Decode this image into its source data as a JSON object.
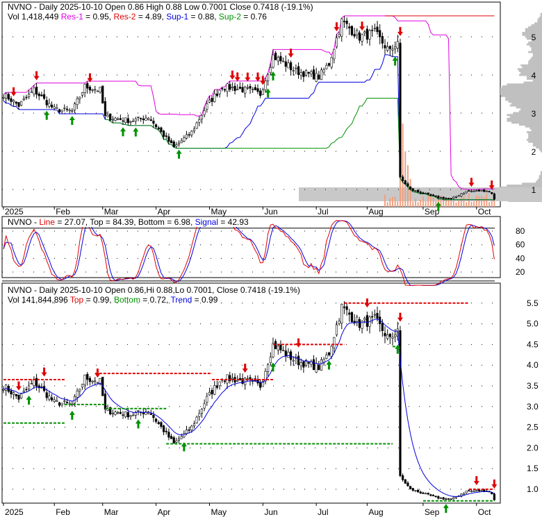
{
  "panel1": {
    "line1": "NVNO - Daily 2025-10-10 Open 0.86  High 0.88  Low 0.7001  Close 0.7418 (-19.1%)",
    "vol": "Vol 1,418,449",
    "res1_label": "Res-1",
    "res1_val": " = 0.95, ",
    "res2_label": "Res-2",
    "res2_val": " = 4.89, ",
    "sup1_label": "Sup-1",
    "sup1_val": " = 0.88, ",
    "sup2_label": "Sup-2",
    "sup2_val": " = 0.76"
  },
  "panel2": {
    "prefix": "NVNO - ",
    "line_label": "Line",
    "rest": " = 27.07, Top = 84.39, Bottom = 6.98, ",
    "signal_label": "Signal",
    "signal_val": " = 42.93"
  },
  "panel3": {
    "line1": "NVNO - Daily 2025-10-10 Open 0.86,Hi 0.88,Lo 0.7001, Close 0.7418 (-19.1%)",
    "vol": "Vol 141,844,896 ",
    "top_label": "Top",
    "top_val": " = 0.99, ",
    "bottom_label": "Bottom",
    "bottom_val": " = 0.72, ",
    "trend_label": "Trend",
    "trend_val": " = 0.99"
  },
  "chart_data": {
    "type": "candlestick",
    "ticker": "NVNO",
    "x_months": [
      {
        "label": "2025",
        "day": 0
      },
      {
        "label": "Feb",
        "day": 20
      },
      {
        "label": "Mar",
        "day": 39
      },
      {
        "label": "Apr",
        "day": 60
      },
      {
        "label": "May",
        "day": 81
      },
      {
        "label": "Jun",
        "day": 102
      },
      {
        "label": "Jul",
        "day": 123
      },
      {
        "label": "Aug",
        "day": 143
      },
      {
        "label": "Sep",
        "day": 165
      },
      {
        "label": "Oct",
        "day": 186
      }
    ],
    "close_keypoints": [
      [
        0,
        3.5
      ],
      [
        6,
        3.2
      ],
      [
        12,
        3.6
      ],
      [
        20,
        3.1
      ],
      [
        27,
        3.05
      ],
      [
        32,
        3.7
      ],
      [
        38,
        3.6
      ],
      [
        40,
        2.9
      ],
      [
        50,
        2.8
      ],
      [
        57,
        2.9
      ],
      [
        62,
        2.5
      ],
      [
        67,
        2.1
      ],
      [
        74,
        2.5
      ],
      [
        80,
        3.2
      ],
      [
        86,
        3.7
      ],
      [
        96,
        3.6
      ],
      [
        101,
        3.5
      ],
      [
        106,
        4.5
      ],
      [
        115,
        4.1
      ],
      [
        124,
        3.95
      ],
      [
        128,
        4.3
      ],
      [
        133,
        5.4
      ],
      [
        140,
        5.0
      ],
      [
        146,
        5.1
      ],
      [
        152,
        4.6
      ],
      [
        155,
        4.9
      ],
      [
        156,
        1.3
      ],
      [
        160,
        1.0
      ],
      [
        170,
        0.8
      ],
      [
        176,
        0.75
      ],
      [
        182,
        0.95
      ],
      [
        190,
        0.97
      ],
      [
        192,
        0.9
      ],
      [
        193,
        0.74
      ]
    ],
    "last_day": 193,
    "panel1_yticks": [
      1,
      2,
      3,
      4,
      5
    ],
    "panel2_yticks": [
      20,
      40,
      60,
      80
    ],
    "panel3_yticks": [
      1.0,
      1.5,
      2.0,
      2.5,
      3.0,
      3.5,
      4.0,
      4.5,
      5.0,
      5.5
    ],
    "panel1_sell_arrows": [
      4,
      13,
      34,
      90,
      92,
      96,
      100,
      102,
      113,
      131,
      141,
      156,
      184,
      192
    ],
    "panel1_buy_arrows": [
      17,
      27,
      47,
      52,
      69,
      104,
      106,
      154,
      171
    ],
    "panel3_sell_arrows": [
      6,
      16,
      37,
      95,
      116,
      143,
      156,
      186,
      193
    ],
    "panel3_buy_arrows": [
      10,
      27,
      53,
      71,
      106,
      128,
      155,
      174
    ],
    "panel3_top_levels": [
      [
        0,
        24,
        3.65
      ],
      [
        36,
        82,
        3.8
      ],
      [
        82,
        106,
        3.65
      ],
      [
        106,
        134,
        4.5
      ],
      [
        134,
        183,
        5.5
      ],
      [
        183,
        193,
        1.0
      ]
    ],
    "panel3_bottom_levels": [
      [
        0,
        24,
        2.6
      ],
      [
        24,
        40,
        3.05
      ],
      [
        40,
        64,
        2.95
      ],
      [
        64,
        153,
        2.1
      ],
      [
        153,
        156,
        4.45
      ],
      [
        165,
        193,
        0.72
      ]
    ],
    "colors": {
      "up": "#000000",
      "res1": "#e000e0",
      "res2": "#e00000",
      "sup1": "#0000e0",
      "sup2": "#009000",
      "volume": "#f0a080",
      "profile": "#c0c0c0"
    }
  }
}
